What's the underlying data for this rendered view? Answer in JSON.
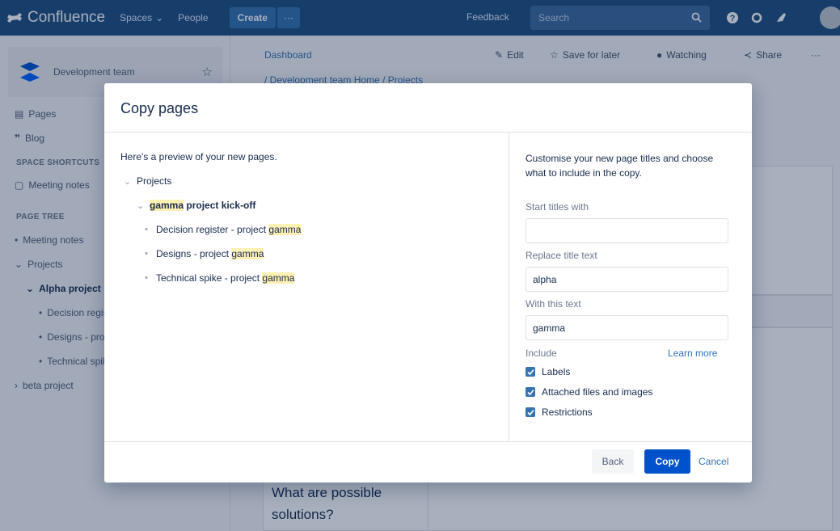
{
  "topnav": {
    "app_name": "Confluence",
    "spaces_label": "Spaces",
    "people_label": "People",
    "create_label": "Create",
    "more_label": "···",
    "feedback_label": "Feedback",
    "search_placeholder": "Search",
    "colors": {
      "bar": "#205081",
      "create": "#3572b0"
    }
  },
  "sidebar": {
    "space_name": "Development team",
    "items": [
      {
        "label": "Pages",
        "icon": "pages-icon"
      },
      {
        "label": "Blog",
        "icon": "blog-icon"
      }
    ],
    "shortcuts_header": "SPACE SHORTCUTS",
    "shortcuts": [
      {
        "label": "Meeting notes",
        "icon": "shortcut-icon"
      }
    ],
    "tree_header": "PAGE TREE",
    "tree": [
      {
        "label": "Meeting notes",
        "bullet": "•"
      },
      {
        "label": "Projects",
        "bullet": "⌄"
      },
      {
        "label": "Alpha project kick-off",
        "bullet": "⌄"
      },
      {
        "label": "Decision register",
        "bullet": "•"
      },
      {
        "label": "Designs - project alpha",
        "bullet": "•"
      },
      {
        "label": "Technical spike",
        "bullet": "•"
      },
      {
        "label": "beta project",
        "bullet": "›"
      }
    ]
  },
  "page": {
    "breadcrumb_top": "Dashboard",
    "breadcrumb_path": "/ Development team Home / Projects",
    "actions": {
      "edit": "Edit",
      "save_for_later": "Save for later",
      "watching": "Watching",
      "share": "Share",
      "more": "···"
    },
    "body_text": "What are possible solutions?"
  },
  "modal": {
    "title": "Copy pages",
    "preview_intro": "Here's a preview of your new pages.",
    "tree": {
      "root": "Projects",
      "parent_hl": "gamma",
      "parent_rest": " project kick-off",
      "children": [
        {
          "prefix": "Decision register - project ",
          "hl": "gamma"
        },
        {
          "prefix": "Designs - project ",
          "hl": "gamma"
        },
        {
          "prefix": "Technical spike - project ",
          "hl": "gamma"
        }
      ]
    },
    "right_intro": "Customise your new page titles and choose what to include in the copy.",
    "start_titles_label": "Start titles with",
    "start_titles_value": "",
    "replace_label": "Replace title text",
    "replace_value": "alpha",
    "with_label": "With this text",
    "with_value": "gamma",
    "include_label": "Include",
    "learn_more": "Learn more",
    "checks": [
      {
        "label": "Labels",
        "checked": true
      },
      {
        "label": "Attached files and images",
        "checked": true
      },
      {
        "label": "Restrictions",
        "checked": true
      }
    ],
    "back_label": "Back",
    "copy_label": "Copy",
    "cancel_label": "Cancel",
    "colors": {
      "primary": "#0052cc",
      "highlight": "#fff0b3",
      "link": "#3572b0"
    }
  }
}
